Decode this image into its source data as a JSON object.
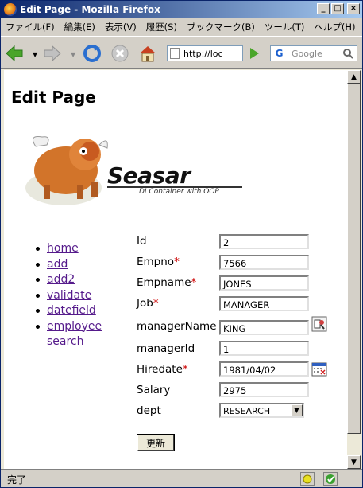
{
  "window": {
    "title": "Edit Page - Mozilla Firefox",
    "buttons": {
      "minimize": "_",
      "maximize": "□",
      "close": "×"
    }
  },
  "menu": [
    "ファイル(F)",
    "編集(E)",
    "表示(V)",
    "履歴(S)",
    "ブックマーク(B)",
    "ツール(T)",
    "ヘルプ(H)"
  ],
  "toolbar": {
    "url": "http://loc",
    "search_placeholder": "Google",
    "search_engine_icon": "G"
  },
  "page": {
    "heading": "Edit Page",
    "logo": {
      "name": "Seasar",
      "tagline": "DI Container with OOP"
    },
    "nav": [
      {
        "label": "home"
      },
      {
        "label": "add"
      },
      {
        "label": "add2"
      },
      {
        "label": "validate"
      },
      {
        "label": "datefield"
      },
      {
        "label": "employee search"
      }
    ],
    "form": {
      "fields": [
        {
          "label": "Id",
          "required": false,
          "value": "2"
        },
        {
          "label": "Empno",
          "required": true,
          "value": "7566"
        },
        {
          "label": "Empname",
          "required": true,
          "value": "JONES"
        },
        {
          "label": "Job",
          "required": true,
          "value": "MANAGER"
        },
        {
          "label": "managerName",
          "required": false,
          "value": "KING"
        },
        {
          "label": "managerId",
          "required": false,
          "value": "1"
        },
        {
          "label": "Hiredate",
          "required": true,
          "value": "1981/04/02"
        },
        {
          "label": "Salary",
          "required": false,
          "value": "2975"
        }
      ],
      "dept": {
        "label": "dept",
        "value": "RESEARCH"
      },
      "required_mark": "*",
      "submit_label": "更新"
    }
  },
  "status": {
    "text": "完了"
  },
  "colors": {
    "required": "#cc0000",
    "link": "#551a8b",
    "title_bar": "#0a246a"
  }
}
